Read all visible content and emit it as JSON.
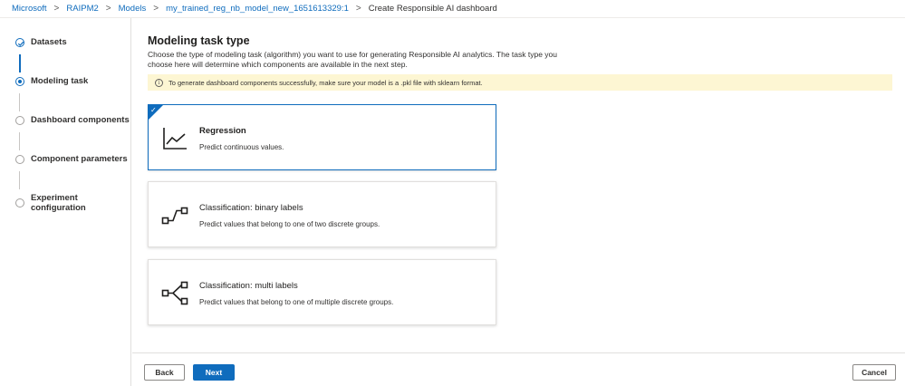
{
  "breadcrumb": {
    "items": [
      "Microsoft",
      "RAIPM2",
      "Models",
      "my_trained_reg_nb_model_new_1651613329:1"
    ],
    "current": "Create Responsible AI dashboard"
  },
  "stepper": {
    "steps": [
      {
        "label": "Datasets",
        "state": "done"
      },
      {
        "label": "Modeling task",
        "state": "current"
      },
      {
        "label": "Dashboard components",
        "state": "pending"
      },
      {
        "label": "Component parameters",
        "state": "pending"
      },
      {
        "label": "Experiment configuration",
        "state": "pending"
      }
    ]
  },
  "main": {
    "title": "Modeling task type",
    "description": "Choose the type of modeling task (algorithm) you want to use for generating Responsible AI analytics. The task type you choose here will determine which components are available in the next step.",
    "banner": "To generate dashboard components successfully, make sure your model is a .pkl file with sklearn format.",
    "cards": [
      {
        "title": "Regression",
        "subtitle": "Predict continuous values.",
        "selected": true,
        "icon": "regression-icon"
      },
      {
        "title": "Classification: binary labels",
        "subtitle": "Predict values that belong to one of two discrete groups.",
        "selected": false,
        "icon": "binary-classification-icon"
      },
      {
        "title": "Classification: multi labels",
        "subtitle": "Predict values that belong to one of multiple discrete groups.",
        "selected": false,
        "icon": "multi-classification-icon"
      }
    ]
  },
  "footer": {
    "back_label": "Back",
    "next_label": "Next",
    "cancel_label": "Cancel"
  },
  "colors": {
    "accent": "#0f6cbd",
    "banner_bg": "#fdf6d3"
  }
}
